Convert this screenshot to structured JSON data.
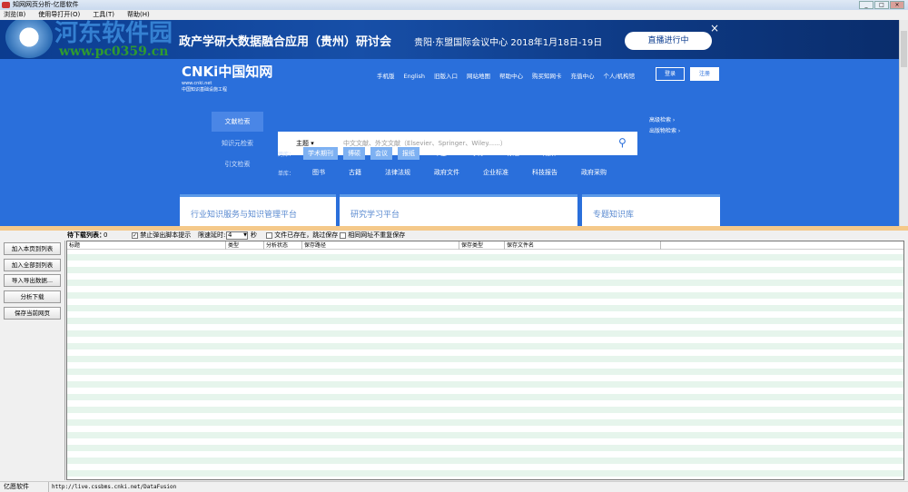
{
  "window": {
    "title": "知网网页分析-亿愿软件",
    "min": "_",
    "max": "□",
    "close": "×"
  },
  "menu": [
    "浏览(B)",
    "使用导打开(O)",
    "工具(T)",
    "帮助(H)"
  ],
  "watermark": {
    "text": "河东软件园",
    "url": "www.pc0359.cn"
  },
  "banner": {
    "headline": "政产学研大数据融合应用（贵州）研讨会",
    "location": "贵阳·东盟国际会议中心  2018年1月18日-19日",
    "live_button": "直播进行中",
    "close": "×"
  },
  "cnki": {
    "logo": "CNKi中国知网",
    "logo_url": "www.cnki.net",
    "logo_sub": "中国知识基础设施工程",
    "nav": [
      "手机版",
      "English",
      "旧版入口",
      "网站地图",
      "帮助中心",
      "购买知网卡",
      "充值中心",
      "个人/机构馆"
    ],
    "login": "登录",
    "register": "注册",
    "tabs": [
      "文献检索",
      "知识元检索",
      "引文检索"
    ],
    "search": {
      "field": "主题 ▾",
      "placeholder": "中文文献、外文文献（Elsevier、Springer、Wiley......）"
    },
    "advanced": "高级检索 ›",
    "publication": "出版物检索 ›",
    "cross_label": "跨库：",
    "cross": [
      "学术期刊",
      "博硕",
      "会议",
      "报纸"
    ],
    "cross_plain": [
      "年鉴",
      "专利",
      "标准",
      "成果"
    ],
    "single_label": "单库：",
    "single": [
      "图书",
      "古籍",
      "法律法规",
      "政府文件",
      "企业标准",
      "科技报告",
      "政府采购"
    ],
    "cards": [
      "行业知识服务与知识管理平台",
      "研究学习平台",
      "专题知识库"
    ]
  },
  "toolbar": {
    "pending_label": "待下载列表：",
    "pending_count": "0",
    "block_script": "禁止弹出脚本提示",
    "block_script_checked": true,
    "delay_label": "限速延时:",
    "delay_value": "4",
    "delay_unit": "秒",
    "skip_exist": "文件已存在，跳过保存",
    "skip_dup": "相同网址不重复保存"
  },
  "buttons": [
    "加入本页到列表",
    "加入全部到列表",
    "导入导出数据...",
    "分析下载",
    "保存当前网页"
  ],
  "columns": [
    "标题",
    "类型",
    "分析状态",
    "保存路径",
    "保存类型",
    "保存文件名"
  ],
  "status": {
    "left": "亿愿软件",
    "url": "http://live.cssbms.cnki.net/DataFusion"
  }
}
